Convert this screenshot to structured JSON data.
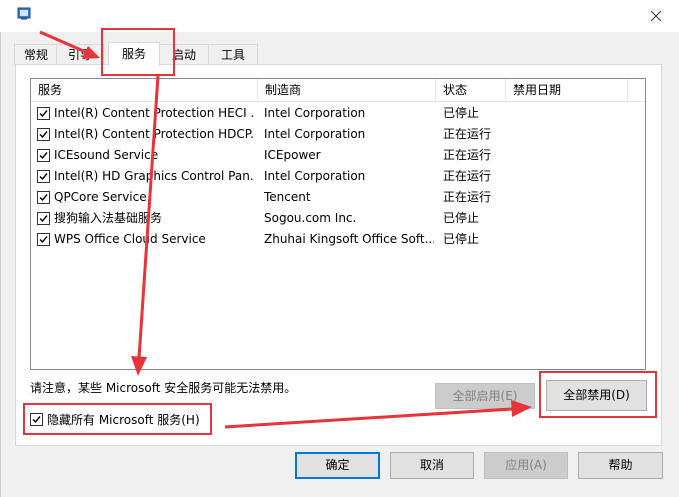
{
  "tabs": [
    {
      "label": "常规"
    },
    {
      "label": "引导"
    },
    {
      "label": "服务"
    },
    {
      "label": "启动"
    },
    {
      "label": "工具"
    }
  ],
  "columns": {
    "service": "服务",
    "manufacturer": "制造商",
    "status": "状态",
    "disabled_date": "禁用日期"
  },
  "services": [
    {
      "name": "Intel(R) Content Protection HECI ...",
      "manufacturer": "Intel Corporation",
      "status": "已停止",
      "checked": true
    },
    {
      "name": "Intel(R) Content Protection HDCP...",
      "manufacturer": "Intel Corporation",
      "status": "正在运行",
      "checked": true
    },
    {
      "name": "ICEsound Service",
      "manufacturer": "ICEpower",
      "status": "正在运行",
      "checked": true
    },
    {
      "name": "Intel(R) HD Graphics Control Pan...",
      "manufacturer": "Intel Corporation",
      "status": "正在运行",
      "checked": true
    },
    {
      "name": "QPCore Service",
      "manufacturer": "Tencent",
      "status": "正在运行",
      "checked": true
    },
    {
      "name": "搜狗输入法基础服务",
      "manufacturer": "Sogou.com Inc.",
      "status": "已停止",
      "checked": true
    },
    {
      "name": "WPS Office Cloud Service",
      "manufacturer": "Zhuhai Kingsoft Office Soft...",
      "status": "已停止",
      "checked": true
    }
  ],
  "note": "请注意，某些 Microsoft 安全服务可能无法禁用。",
  "buttons": {
    "enable_all": "全部启用(E)",
    "disable_all": "全部禁用(D)",
    "ok": "确定",
    "cancel": "取消",
    "apply": "应用(A)",
    "help": "帮助"
  },
  "hide_ms": {
    "label": "隐藏所有 Microsoft 服务(H)",
    "checked": true
  },
  "colors": {
    "annotation": "#e8333a",
    "focus": "#0078d7"
  }
}
